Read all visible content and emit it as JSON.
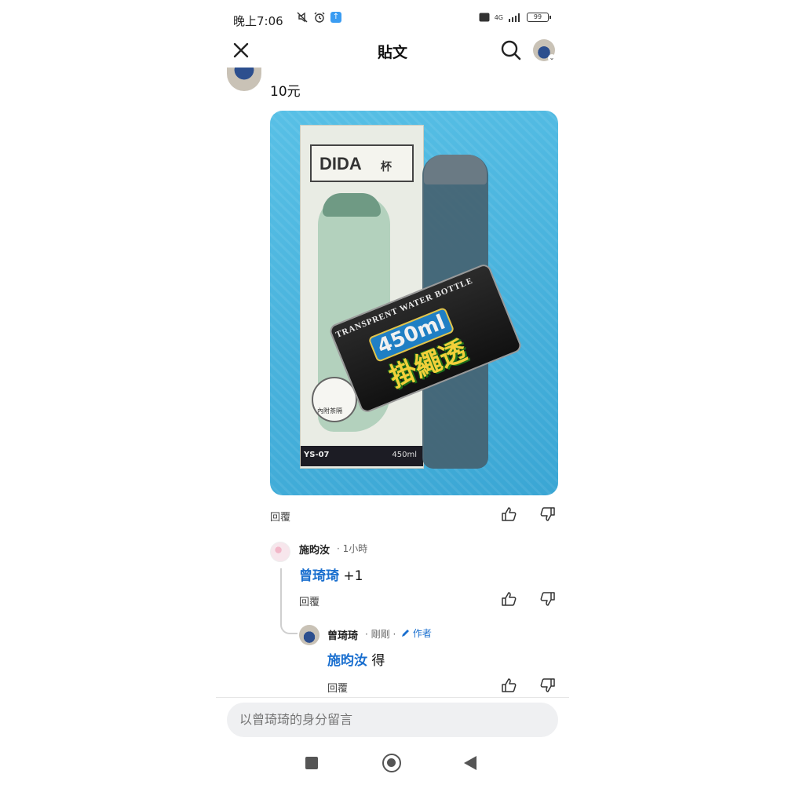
{
  "status_bar": {
    "time": "晚上7:06",
    "network": "4G",
    "battery": "99"
  },
  "header": {
    "title": "貼文",
    "close_icon": "close-icon",
    "search_icon": "search-icon"
  },
  "top_comment": {
    "text": "10元",
    "reply_label": "回覆"
  },
  "photo": {
    "box_brand": "DIDA",
    "box_brand_sub": "杯",
    "box_model": "YS-07",
    "box_volume": "450ml",
    "box_circle_text": "內附茶隔",
    "sticker_top": "TRANSPRENT WATER BOTTLE",
    "sticker_volume": "450ml",
    "sticker_main": "掛繩透"
  },
  "reply_1": {
    "name": "施昀汝",
    "time": "· 1小時",
    "mention": "曾琦琦",
    "text": "+1",
    "reply_label": "回覆"
  },
  "reply_2": {
    "name": "曾琦琦",
    "time": "· 剛剛 ·",
    "badge": "作者",
    "mention": "施昀汝",
    "text": "得",
    "reply_label": "回覆"
  },
  "composer": {
    "placeholder": "以曾琦琦的身分留言"
  },
  "colors": {
    "mention": "#1a6fcf",
    "photo_bg": "#4fb6de",
    "input_bg": "#eff0f2"
  }
}
